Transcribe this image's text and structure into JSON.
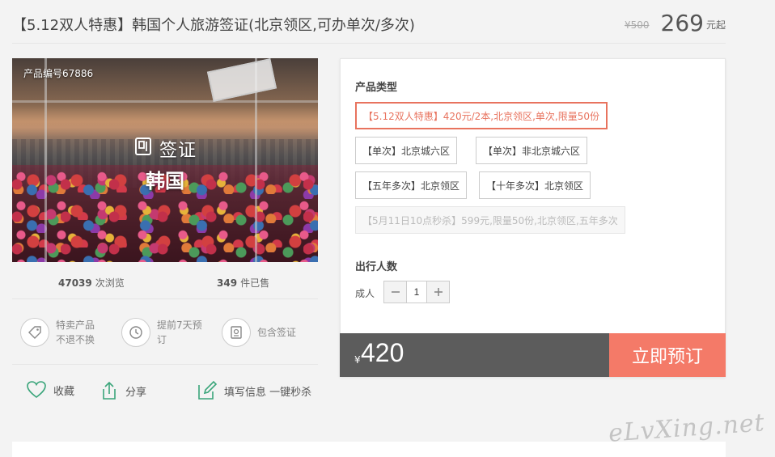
{
  "header": {
    "title": "【5.12双人特惠】韩国个人旅游签证(北京领区,可办单次/多次)",
    "old_price": "¥500",
    "price": "269",
    "price_suffix": "元起"
  },
  "photo": {
    "product_no": "产品编号67886",
    "visa_label": "签证",
    "country": "韩国"
  },
  "stats": {
    "views_count": "47039",
    "views_label": "次浏览",
    "sold_count": "349",
    "sold_label": "件已售"
  },
  "features": [
    {
      "line1": "特卖产品",
      "line2": "不退不换",
      "icon": "tag-icon"
    },
    {
      "line1": "提前7天预",
      "line2": "订",
      "icon": "clock-icon"
    },
    {
      "line1": "包含签证",
      "line2": "",
      "icon": "passport-icon"
    }
  ],
  "actions": {
    "favorite": "收藏",
    "share": "分享",
    "fill_info": "填写信息 一键秒杀"
  },
  "booking": {
    "type_title": "产品类型",
    "options": [
      {
        "label": "【5.12双人特惠】420元/2本,北京领区,单次,限量50份",
        "state": "selected"
      },
      {
        "label": "【单次】北京城六区",
        "state": "normal"
      },
      {
        "label": "【单次】非北京城六区",
        "state": "normal"
      },
      {
        "label": "【五年多次】北京领区",
        "state": "normal"
      },
      {
        "label": "【十年多次】北京领区",
        "state": "normal"
      },
      {
        "label": "【5月11日10点秒杀】599元,限量50份,北京领区,五年多次",
        "state": "disabled"
      }
    ],
    "people_title": "出行人数",
    "adult_label": "成人",
    "quantity": "1",
    "currency_symbol": "¥",
    "total": "420",
    "book_button": "立即预订"
  },
  "colors": {
    "accent": "#f47a68",
    "selected_border": "#e8735e",
    "icon_green": "#3aa57a",
    "total_bar": "#5c5c5c"
  },
  "watermark": "eLvXing.net"
}
